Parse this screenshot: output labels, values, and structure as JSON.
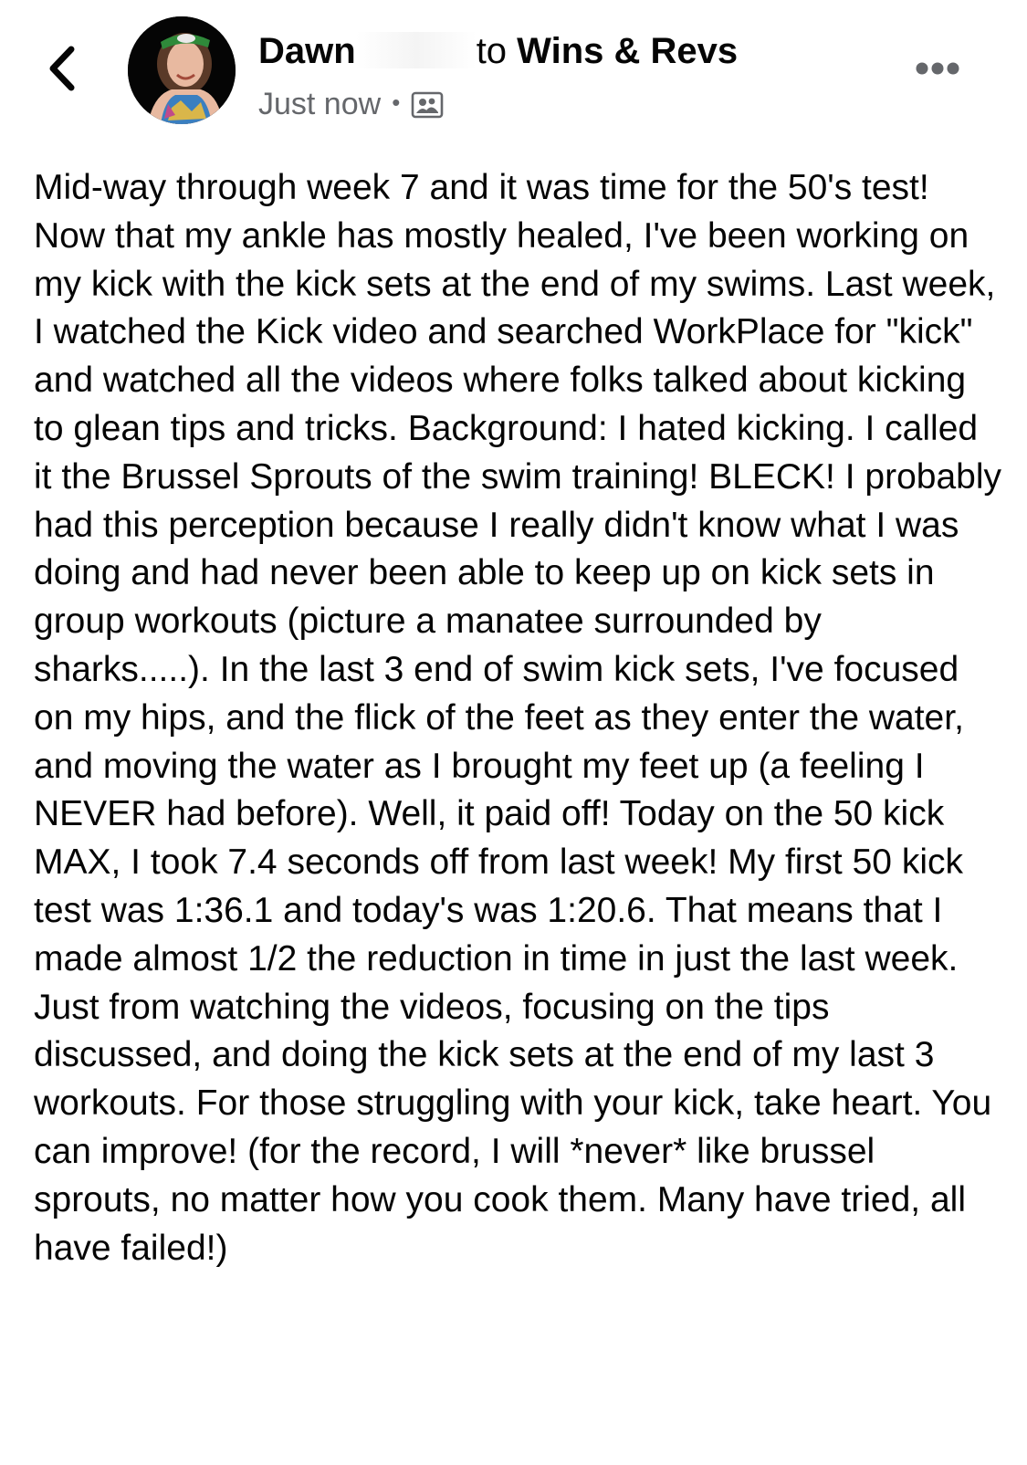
{
  "header": {
    "author_name": "Dawn",
    "to_word": "to",
    "group_name": "Wins & Revs",
    "timestamp": "Just now",
    "separator": "•"
  },
  "icons": {
    "back": "chevron-left-icon",
    "audience": "group-icon",
    "more": "more-horizontal-icon"
  },
  "post": {
    "text": "Mid-way through week 7 and it was time for the 50's test! Now that my ankle has mostly healed, I've been working on my kick with the kick sets at the end of my swims. Last week, I watched the Kick video and searched WorkPlace for \"kick\" and watched all the videos where folks talked about kicking to glean tips and tricks. Background: I hated kicking. I called it the Brussel Sprouts of the swim training!  BLECK! I probably had this perception because I really didn't know what I was doing and had never been able to keep up on kick sets in group workouts (picture a manatee surrounded by sharks.....). In the last 3 end of swim kick sets, I've focused on my hips, and the flick of the feet as they enter the water, and moving the water as I brought my feet up (a feeling I NEVER had before). Well, it paid off! Today on the 50 kick MAX, I took 7.4 seconds off from last week!  My first 50 kick test was 1:36.1 and today's was 1:20.6.  That means that I made almost 1/2 the reduction in time in just the last week. Just from watching the videos, focusing on the tips discussed, and doing the kick sets at the end of my last 3 workouts.  For those struggling with your kick, take heart.  You can improve! (for the record, I will *never* like brussel sprouts, no matter how you cook them. Many have tried, all have failed!)"
  },
  "colors": {
    "text": "#050505",
    "secondary_text": "#65676b",
    "background": "#ffffff"
  }
}
